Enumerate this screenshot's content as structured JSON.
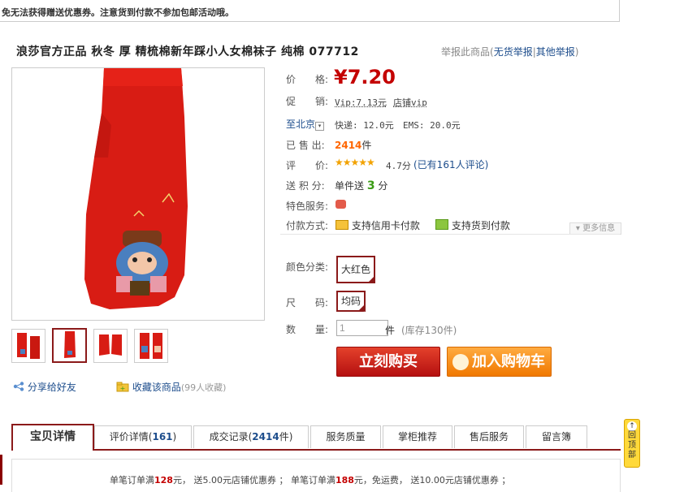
{
  "top_notice": "免无法获得赠送优惠券。注意货到付款不参加包邮活动哦。",
  "title": "浪莎官方正品 秋冬 厚 精梳棉新年踩小人女棉袜子 纯棉 077712",
  "report": {
    "label": "举报此商品",
    "link1": "无货举报",
    "link2": "其他举报"
  },
  "details": {
    "price_label": "价　　格:",
    "price": "¥7.20",
    "promo_label": "促　　销:",
    "promo_vip": "Vip:7.13元",
    "promo_shop": "店铺vip",
    "ship_label": "至北京",
    "ship_express": "快递: 12.0元",
    "ship_ems": "EMS: 20.0元",
    "sold_label": "已 售 出:",
    "sold_count": "2414",
    "sold_unit": "件",
    "rating_label": "评　　价:",
    "rating_score": "4.7分",
    "rating_reviews": "(已有161人评论)",
    "points_label": "送 积 分:",
    "points_text": "单件送",
    "points_value": "3",
    "points_unit": "分",
    "service_label": "特色服务:",
    "pay_label": "付款方式:",
    "pay_card": "支持信用卡付款",
    "pay_cod": "支持货到付款",
    "more_info": "更多信息",
    "color_label": "颜色分类:",
    "color_value": "大红色",
    "size_label": "尺　　码:",
    "size_value": "均码",
    "qty_label": "数　　量:",
    "qty_value": "1",
    "qty_unit": "件",
    "stock": "(库存130件)"
  },
  "buttons": {
    "buy": "立刻购买",
    "cart": "加入购物车"
  },
  "share": "分享给好友",
  "favorite": {
    "label": "收藏该商品",
    "count": "(99人收藏)"
  },
  "tabs": [
    {
      "label": "宝贝详情"
    },
    {
      "label": "评价详情(",
      "num": "161",
      "tail": ")"
    },
    {
      "label": "成交记录(",
      "num": "2414",
      "tail": "件)"
    },
    {
      "label": "服务质量"
    },
    {
      "label": "掌柜推荐"
    },
    {
      "label": "售后服务"
    },
    {
      "label": "留言簿"
    }
  ],
  "promo_line": {
    "p1": "单笔订单满",
    "v1": "128",
    "p2": "元， 送5.00元店铺优惠券 ； 单笔订单满",
    "v2": "188",
    "p3": "元，免运费， 送10.00元店铺优惠券 ；"
  },
  "back_top": "回顶部",
  "colors": {
    "accent": "#8b1a1a",
    "price": "#c40000",
    "buy": "#c71a12",
    "cart": "#f58a0b",
    "link": "#1d4d8c"
  }
}
